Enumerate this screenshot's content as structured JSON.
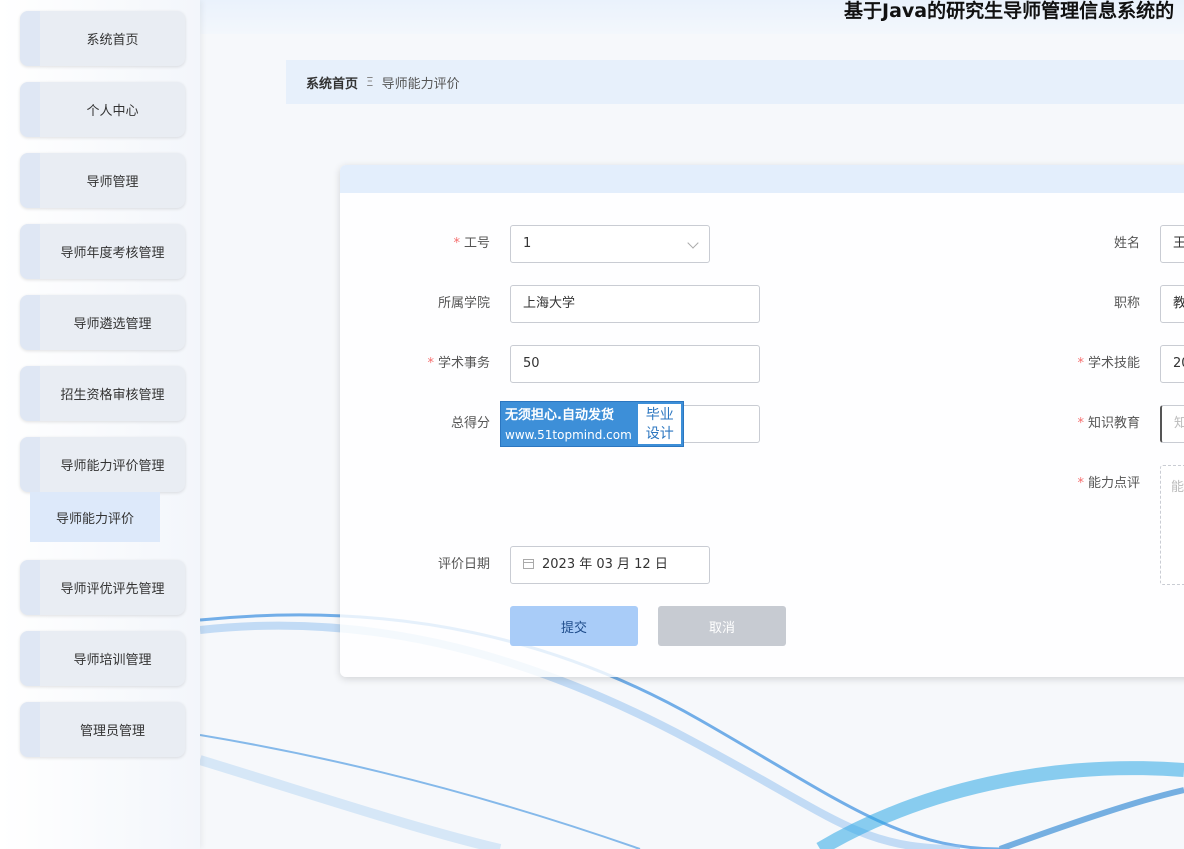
{
  "site": {
    "title": "基于Java的研究生导师管理信息系统的"
  },
  "sidebar": {
    "items": [
      {
        "label": "系统首页"
      },
      {
        "label": "个人中心"
      },
      {
        "label": "导师管理"
      },
      {
        "label": "导师年度考核管理"
      },
      {
        "label": "导师遴选管理"
      },
      {
        "label": "招生资格审核管理"
      },
      {
        "label": "导师能力评价管理"
      },
      {
        "label": "导师评优评先管理"
      },
      {
        "label": "导师培训管理"
      },
      {
        "label": "管理员管理"
      }
    ],
    "submenu": {
      "label": "导师能力评价"
    }
  },
  "breadcrumb": {
    "home": "系统首页",
    "separator": "Ξ",
    "current": "导师能力评价"
  },
  "form": {
    "gonghao": {
      "label": "工号",
      "value": "1"
    },
    "xingming": {
      "label": "姓名",
      "value": "王"
    },
    "xueyuan": {
      "label": "所属学院",
      "value": "上海大学"
    },
    "zhicheng": {
      "label": "职称",
      "value": "教"
    },
    "xueshushiwu": {
      "label": "学术事务",
      "value": "50"
    },
    "xueshujineng": {
      "label": "学术技能",
      "value": "20"
    },
    "zongdefen": {
      "label": "总得分",
      "value": ""
    },
    "zhishijiaoyu": {
      "label": "知识教育",
      "placeholder": "知"
    },
    "nenglidianping": {
      "label": "能力点评",
      "placeholder": "能"
    },
    "pingjiariqi": {
      "label": "评价日期",
      "value": "2023 年 03 月 12 日"
    },
    "submit_label": "提交",
    "cancel_label": "取消"
  },
  "watermark": {
    "line1": "无须担心.自动发货",
    "line2": "www.51topmind.com",
    "badge1": "毕业",
    "badge2": "设计"
  },
  "colors": {
    "accent": "#a9ccf8",
    "required": "#f56c6c",
    "watermark": "#3d8fd8"
  }
}
